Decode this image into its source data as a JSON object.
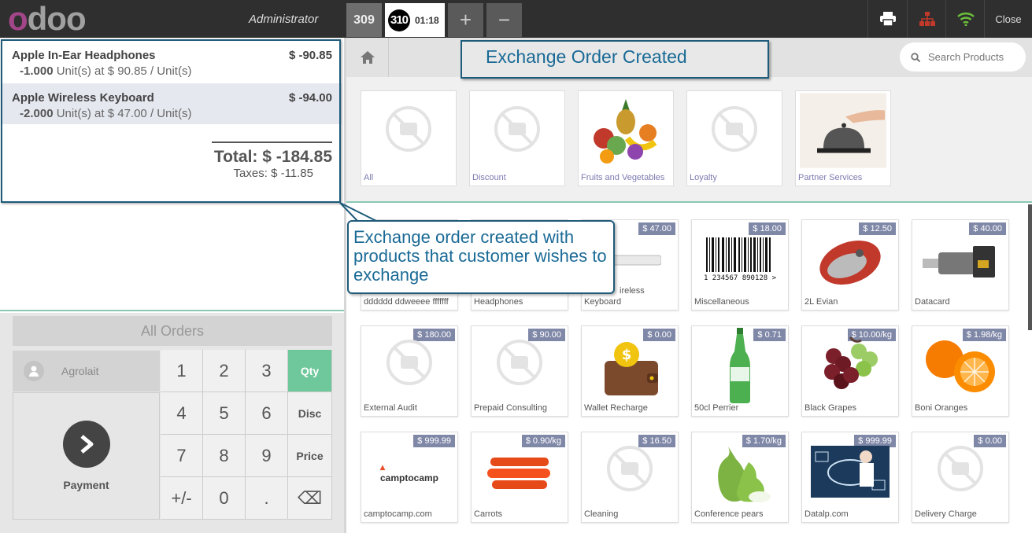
{
  "header": {
    "logo": "odoo",
    "user": "Administrator",
    "orders": [
      {
        "num": "309"
      },
      {
        "num": "310",
        "time": "01:18"
      }
    ],
    "add_label": "+",
    "remove_label": "−",
    "close_label": "Close"
  },
  "orderlines": [
    {
      "name": "Apple In-Ear Headphones",
      "price": "$ -90.85",
      "qty": "-1.000",
      "unit_text": "Unit(s) at $ 90.85 / Unit(s)"
    },
    {
      "name": "Apple Wireless Keyboard",
      "price": "$ -94.00",
      "qty": "-2.000",
      "unit_text": "Unit(s) at $ 47.00 / Unit(s)"
    }
  ],
  "totals": {
    "total": "Total: $ -184.85",
    "taxes": "Taxes: $ -11.85"
  },
  "controls": {
    "all_orders": "All Orders",
    "customer": "Agrolait",
    "payment": "Payment",
    "keys": [
      "1",
      "2",
      "3",
      "Qty",
      "4",
      "5",
      "6",
      "Disc",
      "7",
      "8",
      "9",
      "Price",
      "+/-",
      "0",
      ".",
      "⌫"
    ]
  },
  "annotations": {
    "title": "Exchange Order Created",
    "note": "Exchange order created with products that customer wishes to exchange"
  },
  "search": {
    "placeholder": "Search Products"
  },
  "categories": [
    "All",
    "Discount",
    "Fruits and Vegetables",
    "Loyalty",
    "Partner Services"
  ],
  "products": [
    {
      "name": "dddddd ddweeee fffffff",
      "price": ""
    },
    {
      "name": "Headphones",
      "price": ""
    },
    {
      "name": "Keyboard",
      "price": "$ 47.00"
    },
    {
      "name": "Miscellaneous",
      "price": "$ 18.00"
    },
    {
      "name": "2L Evian",
      "price": "$ 12.50"
    },
    {
      "name": "Datacard",
      "price": "$ 40.00"
    },
    {
      "name": "External Audit",
      "price": "$ 180.00"
    },
    {
      "name": "Prepaid Consulting",
      "price": "$ 90.00"
    },
    {
      "name": "Wallet Recharge",
      "price": "$ 0.00"
    },
    {
      "name": "50cl Perrier",
      "price": "$ 0.71"
    },
    {
      "name": "Black Grapes",
      "price": "$ 10.00/kg"
    },
    {
      "name": "Boni Oranges",
      "price": "$ 1.98/kg"
    },
    {
      "name": "camptocamp.com",
      "price": "$ 999.99"
    },
    {
      "name": "Carrots",
      "price": "$ 0.90/kg"
    },
    {
      "name": "Cleaning",
      "price": "$ 16.50"
    },
    {
      "name": "Conference pears",
      "price": "$ 1.70/kg"
    },
    {
      "name": "Datalp.com",
      "price": "$ 999.99"
    },
    {
      "name": "Delivery Charge",
      "price": "$ 0.00"
    }
  ],
  "barcode_text": "1 234567 890128 >",
  "keyboard_partial": "ireless",
  "brand_logo_text": "camptocamp",
  "colors": {
    "accent": "#6ec89b",
    "callout": "#1e5b7a",
    "price_badge": "#8088a8",
    "logo": "#a24689"
  }
}
